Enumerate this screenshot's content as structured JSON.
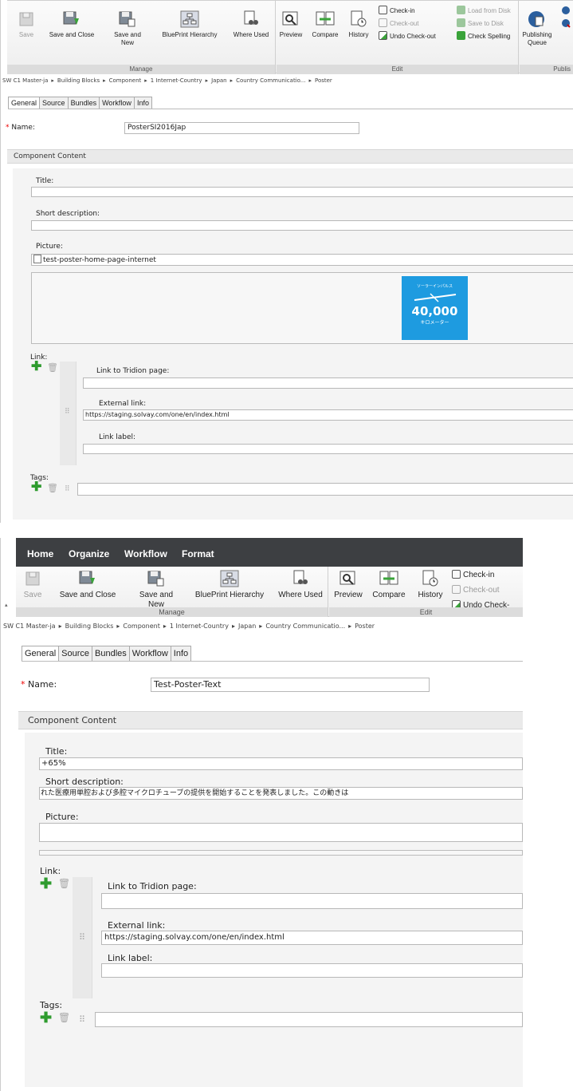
{
  "breadcrumb_sep": "▸",
  "top": {
    "ribbon": {
      "save": "Save",
      "save_close": "Save and Close",
      "save_new": "Save and New",
      "blueprint": "BluePrint Hierarchy",
      "where_used": "Where Used",
      "preview": "Preview",
      "compare": "Compare",
      "history": "History",
      "check_in": "Check-in",
      "check_out": "Check-out",
      "undo_checkout": "Undo Check-out",
      "load_disk": "Load from Disk",
      "save_disk": "Save to Disk",
      "check_spelling": "Check Spelling",
      "publishing_queue": "Publishing Queue",
      "group_manage": "Manage",
      "group_edit": "Edit",
      "group_publish": "Publis"
    },
    "breadcrumb": [
      "SW C1 Master-ja",
      "Building Blocks",
      "Component",
      "1 Internet-Country",
      "Japan",
      "Country Communicatio...",
      "Poster"
    ],
    "tabs": [
      "General",
      "Source",
      "Bundles",
      "Workflow",
      "Info"
    ],
    "name_label": "Name:",
    "name_value": "PosterSI2016Jap",
    "content_header": "Component Content",
    "title_label": "Title:",
    "title_value": "",
    "short_desc_label": "Short description:",
    "short_desc_value": "",
    "picture_label": "Picture:",
    "picture_value": "test-poster-home-page-internet",
    "poster": {
      "jp_top": "ソーラーインパルス",
      "number": "40,000",
      "unit": "キロメーター"
    },
    "link_label": "Link:",
    "tridion_label": "Link to Tridion page:",
    "external_label": "External link:",
    "external_value": "https://staging.solvay.com/one/en/index.html",
    "linklabel_label": "Link label:",
    "tags_label": "Tags:"
  },
  "bottom": {
    "menu": [
      "Home",
      "Organize",
      "Workflow",
      "Format"
    ],
    "ribbon": {
      "save": "Save",
      "save_close": "Save and Close",
      "save_new": "Save and New",
      "blueprint": "BluePrint Hierarchy",
      "where_used": "Where Used",
      "preview": "Preview",
      "compare": "Compare",
      "history": "History",
      "check_in": "Check-in",
      "check_out": "Check-out",
      "undo_checkout": "Undo Check-",
      "group_manage": "Manage",
      "group_edit": "Edit"
    },
    "breadcrumb": [
      "SW C1 Master-ja",
      "Building Blocks",
      "Component",
      "1 Internet-Country",
      "Japan",
      "Country Communicatio...",
      "Poster"
    ],
    "tabs": [
      "General",
      "Source",
      "Bundles",
      "Workflow",
      "Info"
    ],
    "name_label": "Name:",
    "name_value": "Test-Poster-Text",
    "content_header": "Component Content",
    "title_label": "Title:",
    "title_value": "+65%",
    "short_desc_label": "Short description:",
    "short_desc_value": "れた医療用単腔および多腔マイクロチューブの提供を開始することを発表しました。この動きは",
    "picture_label": "Picture:",
    "link_label": "Link:",
    "tridion_label": "Link to Tridion page:",
    "external_label": "External link:",
    "external_value": "https://staging.solvay.com/one/en/index.html",
    "linklabel_label": "Link label:",
    "tags_label": "Tags:"
  }
}
